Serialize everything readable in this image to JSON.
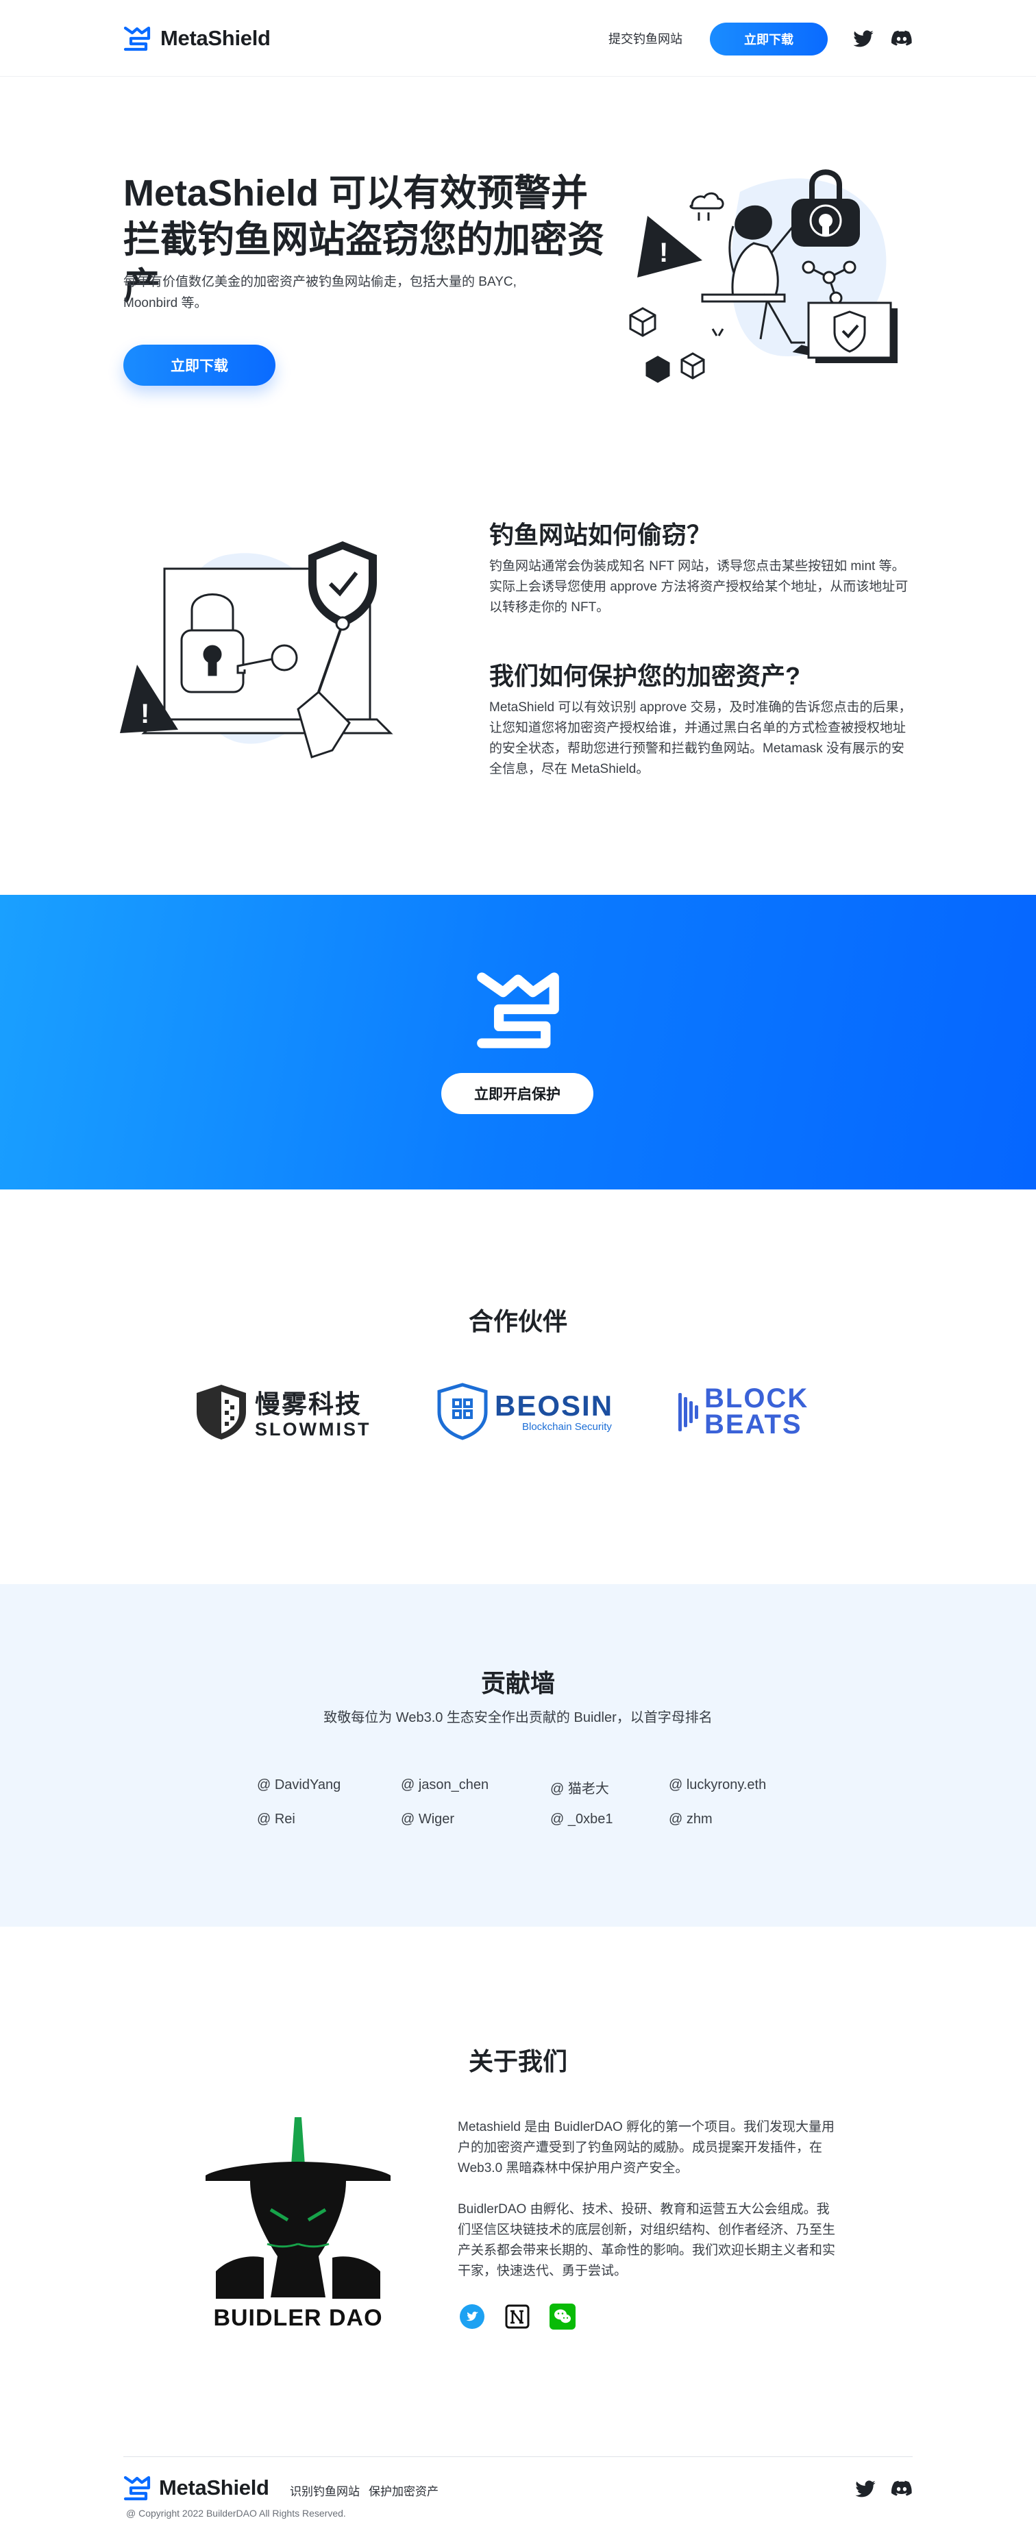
{
  "header": {
    "brand": "MetaShield",
    "nav_submit_phishing": "提交钓鱼网站",
    "download_label": "立即下载"
  },
  "hero": {
    "title_line1": "MetaShield 可以有效预警并",
    "title_line2": "拦截钓鱼网站盗窃您的加密资产",
    "description": "每年有价值数亿美金的加密资产被钓鱼网站偷走，包括大量的 BAYC, Moonbird 等。",
    "cta_label": "立即下载"
  },
  "how_steal": {
    "title": "钓鱼网站如何偷窃？",
    "text": "钓鱼网站通常会伪装成知名 NFT 网站，诱导您点击某些按钮如 mint 等。实际上会诱导您使用 approve 方法将资产授权给某个地址，从而该地址可以转移走你的 NFT。"
  },
  "how_protect": {
    "title": "我们如何保护您的加密资产?",
    "text": "MetaShield 可以有效识别 approve 交易，及时准确的告诉您点击的后果，让您知道您将加密资产授权给谁，并通过黑白名单的方式检查被授权地址的安全状态，帮助您进行预警和拦截钓鱼网站。Metamask 没有展示的安全信息，尽在 MetaShield。"
  },
  "banner": {
    "cta_label": "立即开启保护"
  },
  "partners": {
    "title": "合作伙伴",
    "items": [
      {
        "name_cn": "慢雾科技",
        "name_en": "SLOWMIST"
      },
      {
        "name": "BEOSIN",
        "tagline": "Blockchain Security"
      },
      {
        "line1": "BLOCK",
        "line2": "BEATS"
      }
    ]
  },
  "contributors": {
    "title": "贡献墙",
    "subtitle": "致敬每位为 Web3.0 生态安全作出贡献的 Buidler，以首字母排名",
    "names": [
      "@ DavidYang",
      "@ jason_chen",
      "@ 猫老大",
      "@ luckyrony.eth",
      "@ Rei",
      "@ Wiger",
      "@ _0xbe1",
      "@ zhm"
    ]
  },
  "about": {
    "title": "关于我们",
    "para1": "Metashield 是由 BuidlerDAO 孵化的第一个项目。我们发现大量用户的加密资产遭受到了钓鱼网站的威胁。成员提案开发插件，在 Web3.0 黑暗森林中保护用户资产安全。",
    "para2": "BuidlerDAO 由孵化、技术、投研、教育和运营五大公会组成。我们坚信区块链技术的底层创新，对组织结构、创作者经济、乃至生产关系都会带来长期的、革命性的影响。我们欢迎长期主义者和实干家，快速迭代、勇于尝试。",
    "logo_text": "BUIDLER DAO"
  },
  "footer": {
    "brand": "MetaShield",
    "link1": "识别钓鱼网站",
    "link2": "保护加密资产",
    "copyright": "@ Copyright 2022 BuilderDAO All Rights Reserved."
  },
  "colors": {
    "accent": "#0A6BFF",
    "accent_light": "#1AA0FF",
    "twitter": "#1DA1F2",
    "wechat": "#09BB07"
  }
}
